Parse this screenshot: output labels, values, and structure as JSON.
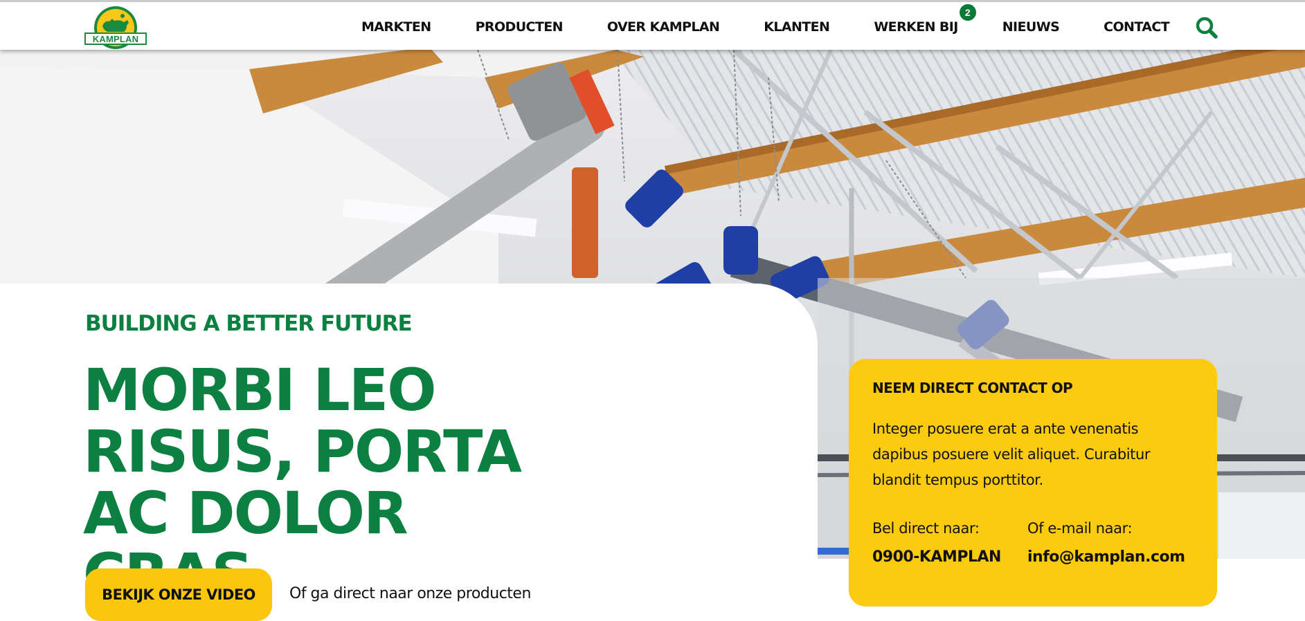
{
  "header": {
    "logo_text": "KAMPLAN",
    "nav": [
      {
        "label": "MARKTEN"
      },
      {
        "label": "PRODUCTEN"
      },
      {
        "label": "OVER KAMPLAN"
      },
      {
        "label": "KLANTEN"
      },
      {
        "label": "WERKEN BIJ",
        "badge": "2"
      },
      {
        "label": "NIEUWS"
      },
      {
        "label": "CONTACT"
      }
    ],
    "search_icon": "search-icon"
  },
  "hero": {
    "eyebrow": "BUILDING A BETTER FUTURE",
    "headline": "MORBI LEO RISUS, PORTA AC DOLOR CRAS.",
    "video_button": "BEKIJK ONZE VIDEO",
    "products_link": "Of ga direct naar onze producten"
  },
  "contact_card": {
    "title": "NEEM DIRECT CONTACT OP",
    "text": "Integer posuere erat a ante venenatis dapibus posuere velit aliquet. Curabitur blandit tempus porttitor.",
    "phone_label": "Bel direct naar:",
    "phone_value": "0900-KAMPLAN",
    "email_label": "Of e-mail naar:",
    "email_value": "info@kamplan.com"
  },
  "colors": {
    "brand_green": "#0c8040",
    "accent_yellow": "#fccb0f",
    "beam_wood": "#c98a3e",
    "motor_blue": "#1f3fa6"
  }
}
